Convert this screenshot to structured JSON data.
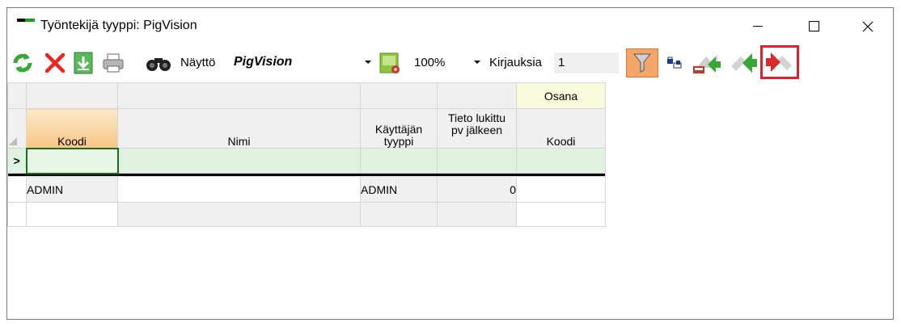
{
  "window": {
    "title": "Työntekijä tyyppi: PigVision"
  },
  "toolbar": {
    "view_label": "Näyttö",
    "view_value": "PigVision",
    "zoom_value": "100%",
    "entries_label": "Kirjauksia",
    "entries_value": "1",
    "icons": [
      "refresh-icon",
      "delete-icon",
      "save-icon",
      "print-icon",
      "binoculars-icon",
      "settings-icon",
      "filter-icon",
      "lock-icon",
      "export-icon",
      "forward-icon",
      "back-icon"
    ],
    "highlight_color": "#e0202a"
  },
  "grid": {
    "group_header": "Osana",
    "columns": {
      "koodi": "Koodi",
      "nimi": "Nimi",
      "tyyppi_line1": "Käyttäjän",
      "tyyppi_line2": "tyyppi",
      "lukittu_line1": "Tieto lukittu",
      "lukittu_line2": "pv jälkeen",
      "osana_koodi": "Koodi"
    },
    "new_row_indicator": ">",
    "rows": [
      {
        "koodi": "ADMIN",
        "nimi": "",
        "tyyppi": "ADMIN",
        "lukittu": "0",
        "osana_koodi": ""
      }
    ]
  }
}
